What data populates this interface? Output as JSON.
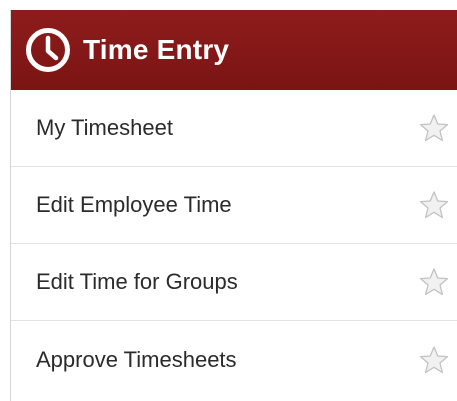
{
  "header": {
    "title": "Time Entry",
    "icon": "clock-icon",
    "background_color": "#861818"
  },
  "menu": {
    "items": [
      {
        "label": "My Timesheet",
        "icon": "star-icon"
      },
      {
        "label": "Edit Employee Time",
        "icon": "star-icon"
      },
      {
        "label": "Edit Time for Groups",
        "icon": "star-icon"
      },
      {
        "label": "Approve Timesheets",
        "icon": "star-icon"
      }
    ]
  }
}
